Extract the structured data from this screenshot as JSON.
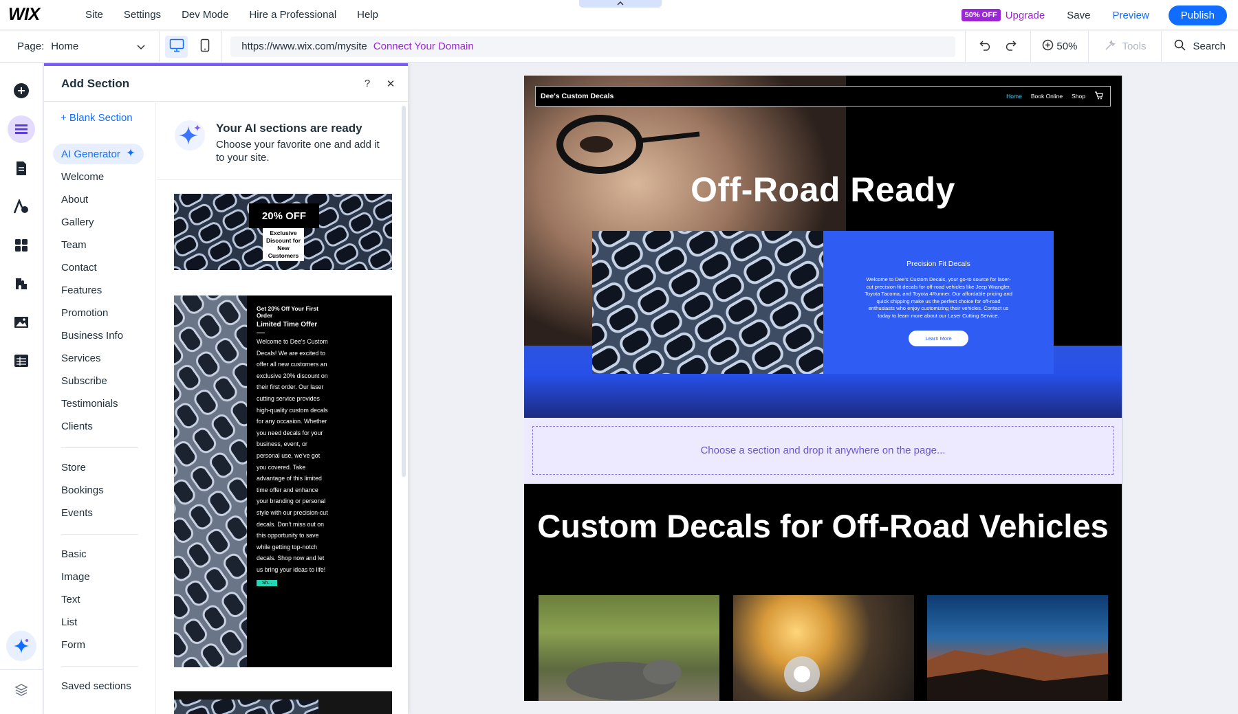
{
  "topbar": {
    "logo": "WIX",
    "menu": [
      "Site",
      "Settings",
      "Dev Mode",
      "Hire a Professional",
      "Help"
    ],
    "discount_badge": "50% OFF",
    "upgrade": "Upgrade",
    "save": "Save",
    "preview": "Preview",
    "publish": "Publish",
    "collapse_icon": "^"
  },
  "toolbar": {
    "page_label": "Page:",
    "page_value": "Home",
    "url": "https://www.wix.com/mysite",
    "connect_domain": "Connect Your Domain",
    "zoom": "50%",
    "tools": "Tools",
    "search": "Search"
  },
  "rail": {
    "icons": [
      "add-elements-icon",
      "sections-icon",
      "pages-icon",
      "design-icon",
      "apps-icon",
      "business-icon",
      "media-icon",
      "cms-icon",
      "ai-assistant-icon",
      "layers-icon"
    ]
  },
  "panel": {
    "title": "Add Section",
    "help": "?",
    "close": "✕",
    "blank_section": "+ Blank Section",
    "ai_generator": "AI Generator",
    "categories_group1": [
      "Welcome",
      "About",
      "Gallery",
      "Team",
      "Contact",
      "Features",
      "Promotion",
      "Business Info",
      "Services",
      "Subscribe",
      "Testimonials",
      "Clients"
    ],
    "categories_group2": [
      "Store",
      "Bookings",
      "Events"
    ],
    "categories_group3": [
      "Basic",
      "Image",
      "Text",
      "List",
      "Form"
    ],
    "saved_sections": "Saved sections",
    "ai_banner_title": "Your AI sections are ready",
    "ai_banner_sub": "Choose your favorite one and add it to your site.",
    "thumb1": {
      "badge": "20% OFF",
      "box": "Exclusive Discount for New Customers"
    },
    "thumb2": {
      "heading": "Get 20% Off Your First Order",
      "subheading": "Limited Time Offer",
      "body": "Welcome to Dee's Custom Decals! We are excited to offer all new customers an exclusive 20% discount on their first order. Our laser cutting service provides high-quality custom decals for any occasion. Whether you need decals for your business, event, or personal use, we've got you covered. Take advantage of this limited time offer and enhance your branding or personal style with our precision-cut decals. Don't miss out on this opportunity to save while getting top-notch decals. Shop now and let us bring your ideas to life!",
      "button": "Sh..."
    }
  },
  "site": {
    "brand": "Dee's Custom Decals",
    "nav": [
      "Home",
      "Book Online",
      "Shop"
    ],
    "hero_title": "Off-Road Ready",
    "card_title": "Precision Fit Decals",
    "card_body": "Welcome to Dee's Custom Decals, your go-to source for laser-cut precision fit decals for off-road vehicles like Jeep Wrangler, Toyota Tacoma, and Toyota 4Runner. Our affordable pricing and quick shipping make us the perfect choice for off-road enthusiasts who enjoy customizing their vehicles. Contact us today to learn more about our Laser Cutting Service.",
    "card_button": "Learn More",
    "drop_hint": "Choose a section and drop it anywhere on the page...",
    "section2_title": "Custom Decals for Off-Road Vehicles"
  },
  "colors": {
    "accent": "#116dff",
    "upgrade_purple": "#9a27d5",
    "site_blue": "#2f5cf2",
    "panel_active": "#7a5af8"
  }
}
